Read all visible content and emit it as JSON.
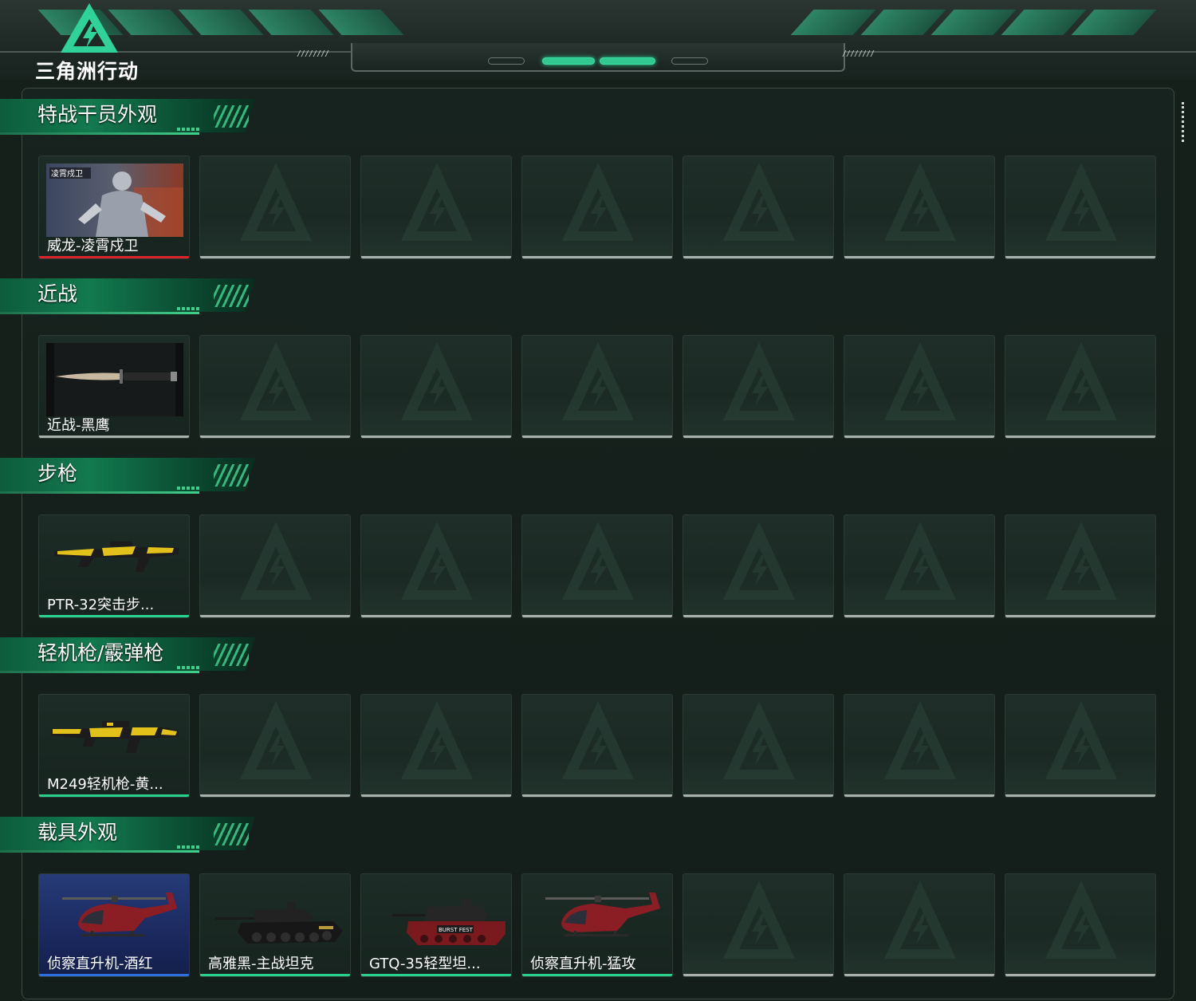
{
  "app": {
    "logo_text": "三角洲行动",
    "header_stripes_left": "////////",
    "header_stripes_right": "////////"
  },
  "colors": {
    "accent": "#2ad18e",
    "rarity_red": "#d8242a",
    "rarity_blue": "#2e6fe0",
    "rarity_green": "#2ad18e"
  },
  "sections": [
    {
      "title": "特战干员外观",
      "items": [
        {
          "name": "威龙-凌霄戍卫",
          "rarity": "red",
          "icon": "operator-portrait"
        },
        {
          "name": "",
          "rarity": "empty"
        },
        {
          "name": "",
          "rarity": "empty"
        },
        {
          "name": "",
          "rarity": "empty"
        },
        {
          "name": "",
          "rarity": "empty"
        },
        {
          "name": "",
          "rarity": "empty"
        },
        {
          "name": "",
          "rarity": "empty"
        }
      ]
    },
    {
      "title": "近战",
      "items": [
        {
          "name": "近战-黑鹰",
          "rarity": "none",
          "icon": "knife"
        },
        {
          "name": "",
          "rarity": "empty"
        },
        {
          "name": "",
          "rarity": "empty"
        },
        {
          "name": "",
          "rarity": "empty"
        },
        {
          "name": "",
          "rarity": "empty"
        },
        {
          "name": "",
          "rarity": "empty"
        },
        {
          "name": "",
          "rarity": "empty"
        }
      ]
    },
    {
      "title": "步枪",
      "items": [
        {
          "name": "PTR-32突击步...",
          "rarity": "green",
          "icon": "rifle"
        },
        {
          "name": "",
          "rarity": "empty"
        },
        {
          "name": "",
          "rarity": "empty"
        },
        {
          "name": "",
          "rarity": "empty"
        },
        {
          "name": "",
          "rarity": "empty"
        },
        {
          "name": "",
          "rarity": "empty"
        },
        {
          "name": "",
          "rarity": "empty"
        }
      ]
    },
    {
      "title": "轻机枪/霰弹枪",
      "items": [
        {
          "name": "M249轻机枪-黄...",
          "rarity": "green",
          "icon": "machine-gun"
        },
        {
          "name": "",
          "rarity": "empty"
        },
        {
          "name": "",
          "rarity": "empty"
        },
        {
          "name": "",
          "rarity": "empty"
        },
        {
          "name": "",
          "rarity": "empty"
        },
        {
          "name": "",
          "rarity": "empty"
        },
        {
          "name": "",
          "rarity": "empty"
        }
      ]
    },
    {
      "title": "载具外观",
      "items": [
        {
          "name": "侦察直升机-酒红",
          "rarity": "blue",
          "icon": "helicopter"
        },
        {
          "name": "高雅黑-主战坦克",
          "rarity": "green",
          "icon": "tank"
        },
        {
          "name": "GTQ-35轻型坦...",
          "rarity": "green",
          "icon": "light-tank"
        },
        {
          "name": "侦察直升机-猛攻",
          "rarity": "green",
          "icon": "helicopter"
        },
        {
          "name": "",
          "rarity": "empty"
        },
        {
          "name": "",
          "rarity": "empty"
        },
        {
          "name": "",
          "rarity": "empty"
        }
      ]
    }
  ]
}
